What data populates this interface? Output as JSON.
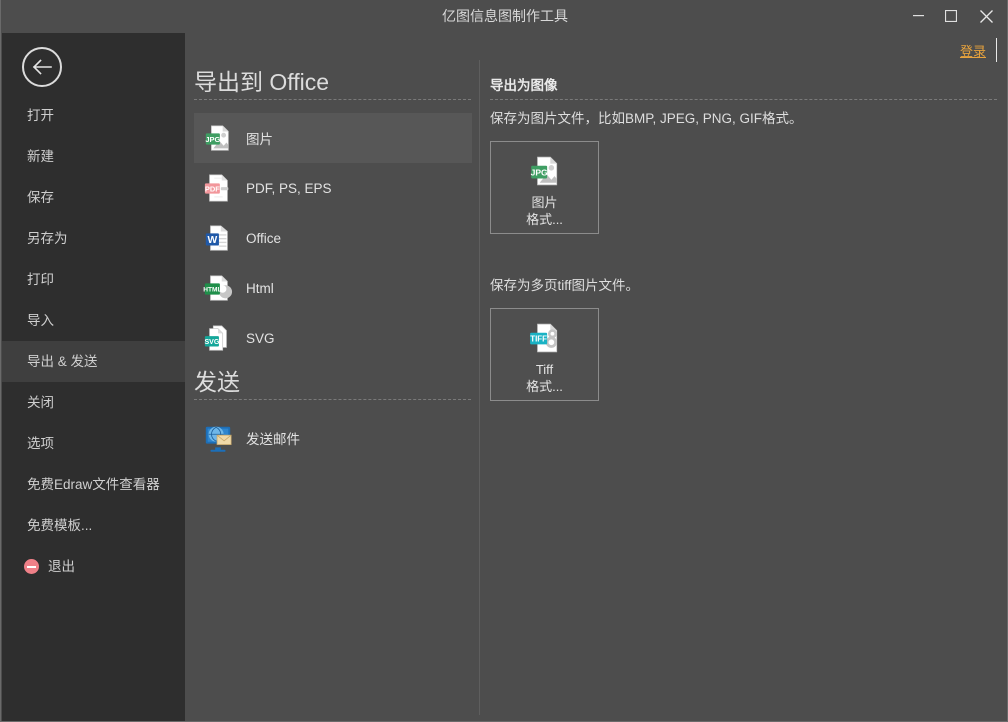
{
  "window": {
    "title": "亿图信息图制作工具",
    "minimize_label": "minimize",
    "maximize_label": "maximize",
    "close_label": "close"
  },
  "account": {
    "login_label": "登录"
  },
  "sidebar": {
    "back_label": "back-arrow",
    "items": [
      {
        "label": "打开",
        "selected": false,
        "icon": ""
      },
      {
        "label": "新建",
        "selected": false,
        "icon": ""
      },
      {
        "label": "保存",
        "selected": false,
        "icon": ""
      },
      {
        "label": "另存为",
        "selected": false,
        "icon": ""
      },
      {
        "label": "打印",
        "selected": false,
        "icon": ""
      },
      {
        "label": "导入",
        "selected": false,
        "icon": ""
      },
      {
        "label": "导出 & 发送",
        "selected": true,
        "icon": ""
      },
      {
        "label": "关闭",
        "selected": false,
        "icon": ""
      },
      {
        "label": "选项",
        "selected": false,
        "icon": ""
      },
      {
        "label": "免费Edraw文件查看器",
        "selected": false,
        "icon": ""
      },
      {
        "label": "免费模板...",
        "selected": false,
        "icon": ""
      },
      {
        "label": "退出",
        "selected": false,
        "icon": "exit-icon"
      }
    ]
  },
  "middle": {
    "export_heading": "导出到 Office",
    "export_options": [
      {
        "label": "图片",
        "icon": "jpg-file-icon",
        "selected": true
      },
      {
        "label": "PDF, PS, EPS",
        "icon": "pdf-file-icon",
        "selected": false
      },
      {
        "label": "Office",
        "icon": "word-file-icon",
        "selected": false
      },
      {
        "label": "Html",
        "icon": "html-file-icon",
        "selected": false
      },
      {
        "label": "SVG",
        "icon": "svg-file-icon",
        "selected": false
      }
    ],
    "send_heading": "发送",
    "send_options": [
      {
        "label": "发送邮件",
        "icon": "send-mail-icon",
        "selected": false
      }
    ]
  },
  "right": {
    "title": "导出为图像",
    "blocks": [
      {
        "description": "保存为图片文件，比如BMP, JPEG, PNG, GIF格式。",
        "tile": {
          "icon": "jpg-file-icon",
          "line1": "图片",
          "line2": "格式..."
        }
      },
      {
        "description": "保存为多页tiff图片文件。",
        "tile": {
          "icon": "tiff-file-icon",
          "line1": "Tiff",
          "line2": "格式..."
        }
      }
    ]
  },
  "colors": {
    "window_bg": "#4d4d4d",
    "sidebar_bg": "#2e2e2e",
    "sidebar_selected": "#3f3f3f",
    "option_selected": "#575757",
    "accent_login": "#e8a33d",
    "text_primary": "#e2e2e2",
    "rule": "#7a7a7a"
  }
}
